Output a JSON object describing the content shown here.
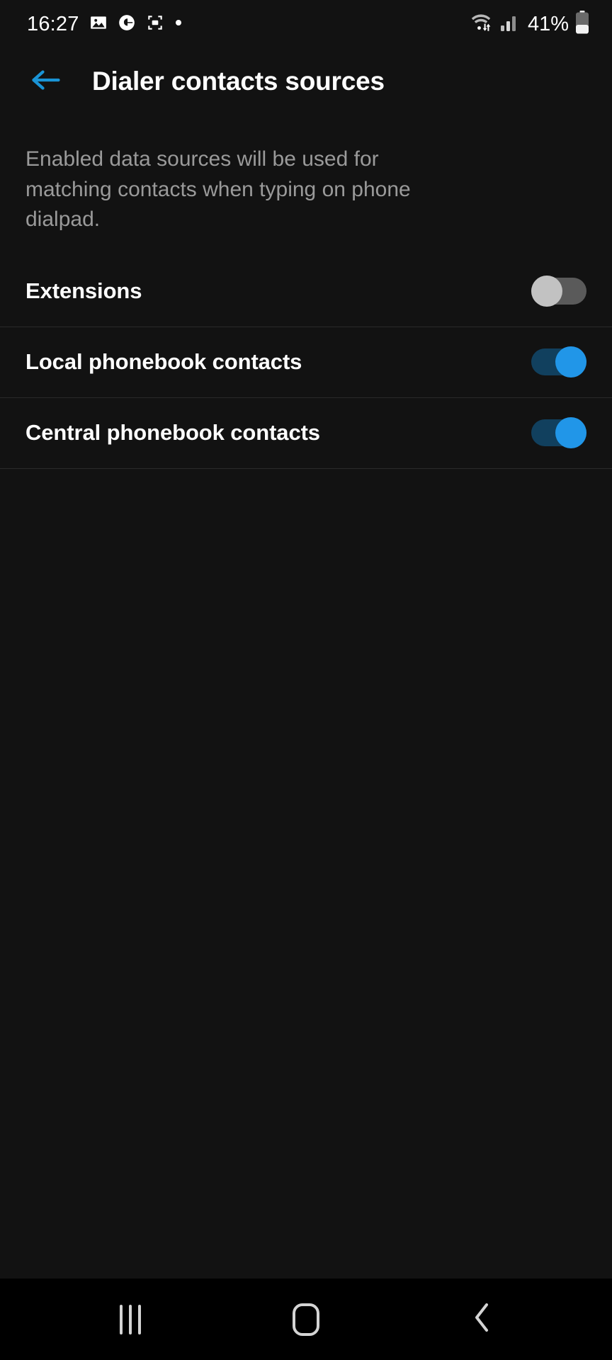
{
  "status_bar": {
    "time": "16:27",
    "battery_percent": "41%",
    "icons": [
      "image-icon",
      "google-assistant-icon",
      "screen-recorder-icon",
      "dot-icon",
      "wifi-data-icon",
      "cellular-signal-icon",
      "battery-icon"
    ]
  },
  "app_bar": {
    "back_icon": "arrow-left-icon",
    "title": "Dialer contacts sources",
    "accent_color": "#1a94d6"
  },
  "description": "Enabled data sources will be used for matching contacts when typing on phone dialpad.",
  "settings": {
    "rows": [
      {
        "label": "Extensions",
        "enabled": false
      },
      {
        "label": "Local phonebook contacts",
        "enabled": true
      },
      {
        "label": "Central phonebook contacts",
        "enabled": true
      }
    ]
  },
  "nav_bar": {
    "recents_label": "Recents",
    "home_label": "Home",
    "back_label": "Back"
  },
  "colors": {
    "background": "#121212",
    "toggle_on": "#2196e8",
    "toggle_on_track": "#11405e",
    "toggle_off": "#c2c2c2",
    "toggle_off_track": "#5a5a5a",
    "divider": "#2a2a2a",
    "secondary_text": "#9a9a9a"
  }
}
